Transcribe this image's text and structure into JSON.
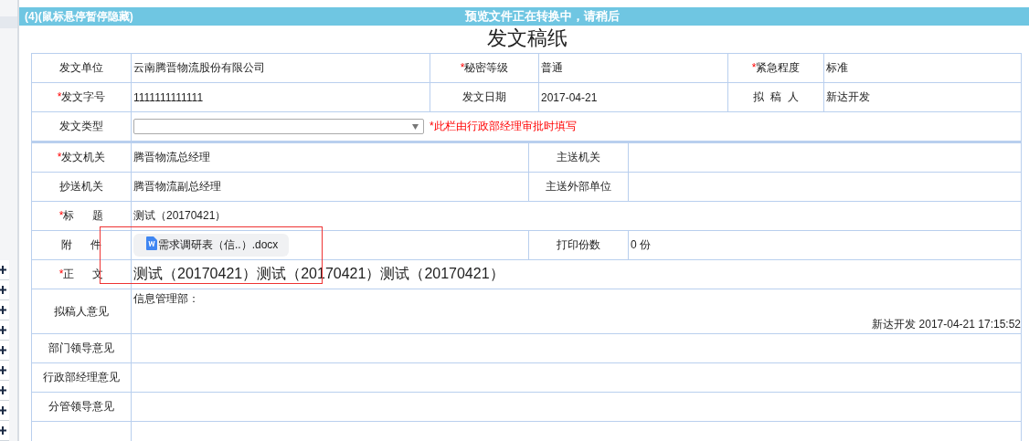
{
  "header": {
    "left_text": "(4)(鼠标悬停暂停隐藏)",
    "center_text": "预览文件正在转换中，请稍后"
  },
  "title": "发文稿纸",
  "top_rows": [
    {
      "cells": [
        {
          "kind": "label",
          "text": "发文单位"
        },
        {
          "kind": "value",
          "text": "云南腾晋物流股份有限公司"
        },
        {
          "kind": "label",
          "mark": "*",
          "text": "秘密等级"
        },
        {
          "kind": "value",
          "text": "普通"
        },
        {
          "kind": "label",
          "mark": "*",
          "text": "紧急程度"
        },
        {
          "kind": "value",
          "text": "标准"
        }
      ]
    },
    {
      "cells": [
        {
          "kind": "label",
          "mark": "*",
          "text": "发文字号"
        },
        {
          "kind": "value",
          "text": "1111111111111"
        },
        {
          "kind": "label",
          "text": "发文日期"
        },
        {
          "kind": "value",
          "text": "2017-04-21"
        },
        {
          "kind": "label",
          "text": "拟  稿  人"
        },
        {
          "kind": "value",
          "text": "新达开发"
        }
      ]
    },
    {
      "cells": [
        {
          "kind": "label",
          "text": "发文类型"
        },
        {
          "kind": "select",
          "note": "*此栏由行政部经理审批时填写"
        }
      ]
    }
  ],
  "bottom_rows": [
    {
      "cells": [
        {
          "kind": "label",
          "mark": "*",
          "text": "发文机关"
        },
        {
          "kind": "value",
          "text": "腾晋物流总经理"
        },
        {
          "kind": "label",
          "text": "主送机关"
        },
        {
          "kind": "value"
        }
      ]
    },
    {
      "cells": [
        {
          "kind": "label",
          "text": "抄送机关"
        },
        {
          "kind": "value",
          "text": "腾晋物流副总经理"
        },
        {
          "kind": "label",
          "text": "主送外部单位"
        },
        {
          "kind": "value"
        }
      ]
    },
    {
      "cells": [
        {
          "kind": "label",
          "mark": "*",
          "text": "标      题"
        },
        {
          "kind": "wide",
          "text": "测试（20170421）"
        }
      ]
    },
    {
      "cells": [
        {
          "kind": "label",
          "text": "附      件"
        },
        {
          "kind": "attachment",
          "file": "需求调研表（信..）.docx"
        },
        {
          "kind": "label",
          "text": "打印份数"
        },
        {
          "kind": "value",
          "text": "0 份"
        }
      ]
    },
    {
      "cells": [
        {
          "kind": "label",
          "mark": "*",
          "text": "正      文"
        },
        {
          "kind": "body",
          "text": "测试（20170421）测试（20170421）测试（20170421）"
        }
      ]
    },
    {
      "cells": [
        {
          "kind": "label",
          "text": "拟稿人意见"
        },
        {
          "kind": "opinion",
          "text": "信息管理部：",
          "signature": "新达开发 2017-04-21 17:15:52"
        }
      ]
    },
    {
      "cells": [
        {
          "kind": "label",
          "text": "部门领导意见"
        },
        {
          "kind": "wide"
        }
      ]
    },
    {
      "cells": [
        {
          "kind": "label",
          "text": "行政部经理意见"
        },
        {
          "kind": "wide"
        }
      ]
    },
    {
      "cells": [
        {
          "kind": "label",
          "text": "分管领导意见"
        },
        {
          "kind": "wide"
        }
      ]
    },
    {
      "cells": [
        {
          "kind": "label"
        },
        {
          "kind": "wide"
        }
      ]
    }
  ]
}
